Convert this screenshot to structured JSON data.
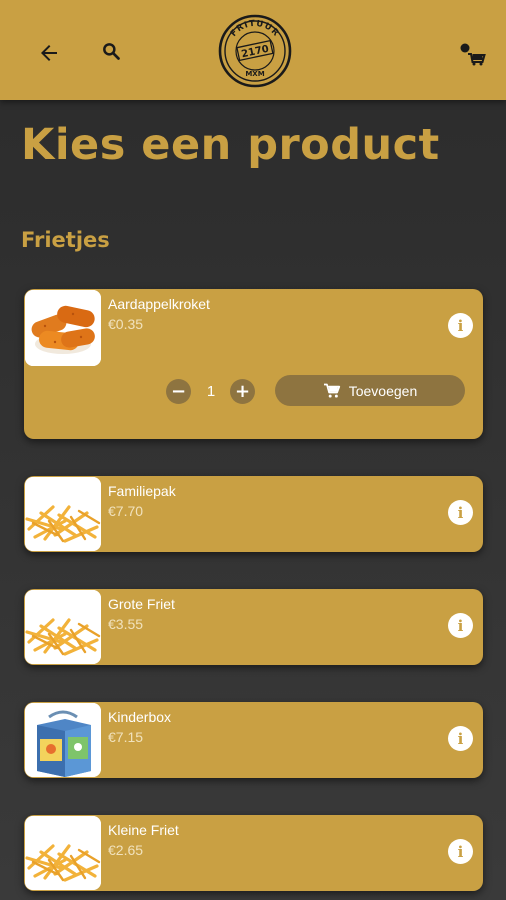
{
  "header": {
    "logo": {
      "top_text": "FRITUUR",
      "number": "2170",
      "bottom_text": "MXM"
    },
    "back_icon": "arrow-left-icon",
    "search_icon": "search-icon",
    "cart_icon": "user-cart-icon"
  },
  "page": {
    "title": "Kies een product"
  },
  "section": {
    "title": "Frietjes"
  },
  "products": [
    {
      "name": "Aardappelkroket",
      "price": "€0.35",
      "image": "croquettes"
    },
    {
      "name": "Familiepak",
      "price": "€7.70",
      "image": "fries"
    },
    {
      "name": "Grote Friet",
      "price": "€3.55",
      "image": "fries"
    },
    {
      "name": "Kinderbox",
      "price": "€7.15",
      "image": "kids-box"
    },
    {
      "name": "Kleine Friet",
      "price": "€2.65",
      "image": "fries"
    }
  ],
  "expanded": {
    "quantity": "1",
    "add_label": "Toevoegen",
    "minus": "−",
    "plus": "+"
  },
  "info_glyph": "i",
  "colors": {
    "brand": "#c9a043",
    "button_dark": "#8e7440",
    "background": "#333333"
  }
}
